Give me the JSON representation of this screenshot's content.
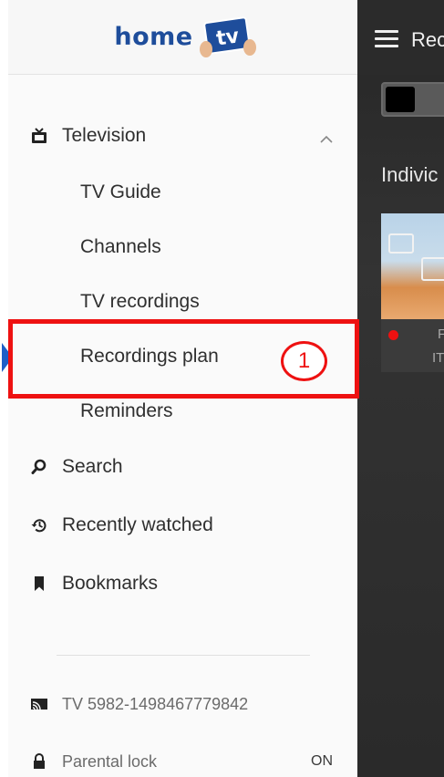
{
  "app": {
    "logo_word": "home",
    "logo_badge": "tv"
  },
  "nav": {
    "television": {
      "label": "Television",
      "icon": "tv-icon",
      "expanded": true
    },
    "television_children": [
      {
        "label": "TV Guide"
      },
      {
        "label": "Channels"
      },
      {
        "label": "TV recordings"
      },
      {
        "label": "Recordings plan",
        "active": true
      },
      {
        "label": "Reminders"
      }
    ],
    "search": {
      "label": "Search",
      "icon": "search-icon"
    },
    "recently_watched": {
      "label": "Recently watched",
      "icon": "history-icon"
    },
    "bookmarks": {
      "label": "Bookmarks",
      "icon": "bookmark-icon"
    }
  },
  "footer": {
    "device": {
      "label": "TV 5982-1498467779842",
      "icon": "cast-icon"
    },
    "parental_lock": {
      "label": "Parental lock",
      "value": "ON",
      "icon": "lock-icon"
    }
  },
  "annotation": {
    "step_number": "1",
    "color": "#ee1111"
  },
  "content": {
    "title_partial": "Rec",
    "section_partial": "Indivic",
    "card_line1_partial": "F",
    "card_line2_partial": "IT"
  },
  "colors": {
    "accent": "#1e5fc7",
    "logo_blue": "#1e4d9b",
    "recording": "#ee1111"
  }
}
